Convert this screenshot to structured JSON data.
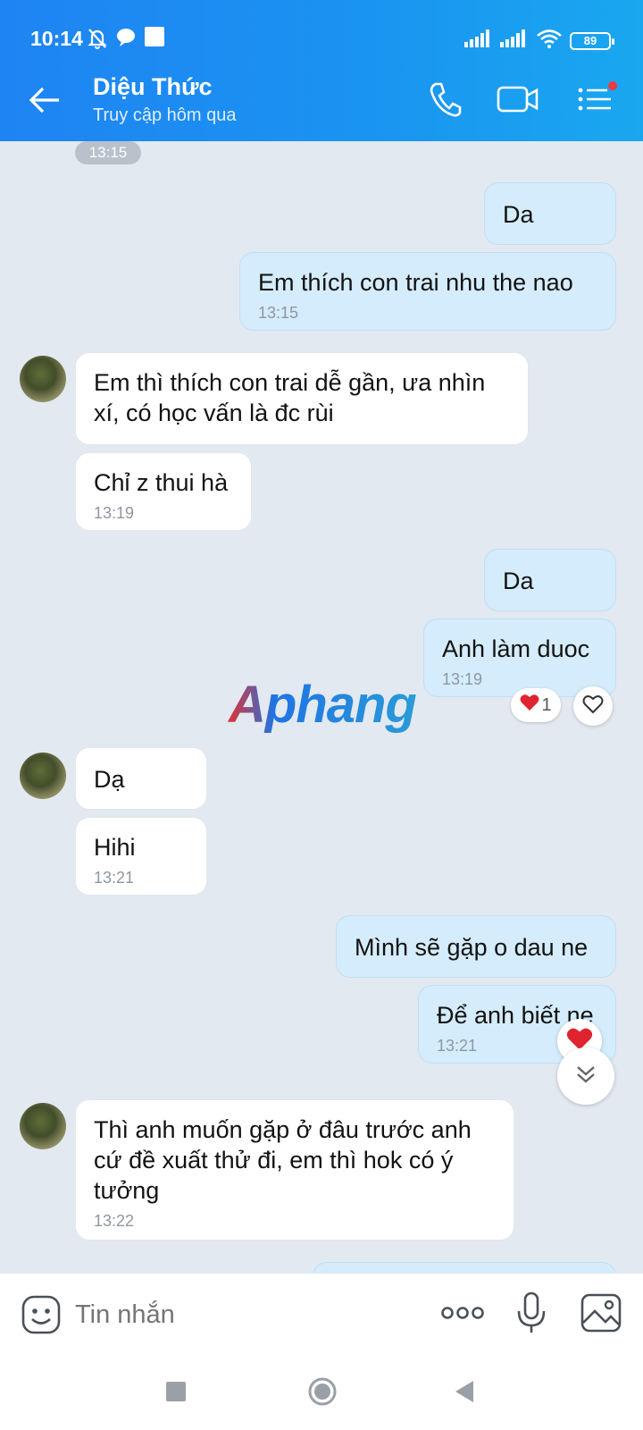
{
  "status_bar": {
    "time": "10:14",
    "battery": "89"
  },
  "header": {
    "contact_name": "Diệu Thức",
    "last_seen": "Truy cập hôm qua"
  },
  "chat": {
    "time_pill": "13:15",
    "watermark": "Aphang",
    "messages": [
      {
        "side": "sent",
        "text": "Da",
        "time": ""
      },
      {
        "side": "sent",
        "text": "Em thích con trai nhu the nao",
        "time": "13:15"
      },
      {
        "side": "received",
        "text": "Em thì thích con trai dễ gần, ưa nhìn xí, có học vấn là đc rùi",
        "time": ""
      },
      {
        "side": "received",
        "text": "Chỉ z thui hà",
        "time": "13:19"
      },
      {
        "side": "sent",
        "text": "Da",
        "time": ""
      },
      {
        "side": "sent",
        "text": "Anh làm duoc",
        "time": "13:19",
        "reaction_count": "1"
      },
      {
        "side": "received",
        "text": "Dạ",
        "time": ""
      },
      {
        "side": "received",
        "text": "Hihi",
        "time": "13:21"
      },
      {
        "side": "sent",
        "text": "Mình sẽ gặp o dau ne",
        "time": ""
      },
      {
        "side": "sent",
        "text": "Để anh biết ne",
        "time": "13:21"
      },
      {
        "side": "received",
        "text": "Thì anh muốn gặp ở đâu trước anh cứ đề xuất thử đi, em thì hok có ý tưởng",
        "time": "13:22"
      }
    ]
  },
  "input": {
    "placeholder": "Tin nhắn"
  },
  "colors": {
    "header_start": "#1f84f3",
    "header_end": "#19a7ef",
    "sent_bubble": "#d4ecfb",
    "received_bubble": "#ffffff",
    "chat_bg": "#e2e9f1",
    "reaction_red": "#e0242f"
  },
  "icons": [
    "back-arrow",
    "phone",
    "video-camera",
    "menu-list",
    "heart",
    "chevron-down",
    "emoji",
    "more-dots",
    "microphone",
    "image",
    "nav-square",
    "nav-circle",
    "nav-triangle"
  ]
}
